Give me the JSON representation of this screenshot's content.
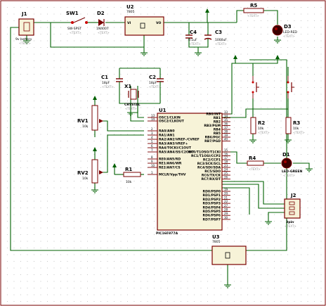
{
  "components": {
    "j1": {
      "ref": "J1",
      "value": "9v battery"
    },
    "sw1": {
      "ref": "SW1",
      "value": "SW-SPST"
    },
    "d2": {
      "ref": "D2",
      "value": "1N4007"
    },
    "u2": {
      "ref": "U2",
      "value": "7805",
      "pin_in": "VI",
      "pin_out": "VO"
    },
    "c4": {
      "ref": "C4",
      "value": "0.1uF"
    },
    "c3": {
      "ref": "C3",
      "value": "1000uF"
    },
    "r5": {
      "ref": "R5"
    },
    "d3": {
      "ref": "D3",
      "value": "LED-RED"
    },
    "c1": {
      "ref": "C1",
      "value": "18pF"
    },
    "c2": {
      "ref": "C2",
      "value": "18pF"
    },
    "x1": {
      "ref": "X1",
      "value": "CRYSTAL"
    },
    "u1": {
      "ref": "U1",
      "value": "PIC16F877A"
    },
    "rv1": {
      "ref": "RV1",
      "value": "10k"
    },
    "rv2": {
      "ref": "RV2",
      "value": "10k"
    },
    "r1": {
      "ref": "R1",
      "value": "10k"
    },
    "r2": {
      "ref": "R2",
      "value": "10k"
    },
    "r3": {
      "ref": "R3",
      "value": "10k"
    },
    "r4": {
      "ref": "R4"
    },
    "d1": {
      "ref": "D1",
      "value": "LED-GREEN"
    },
    "j2": {
      "ref": "J2",
      "value": "3pin"
    },
    "u3": {
      "ref": "U3",
      "value": "7805"
    }
  },
  "placeholder_text": "<TEXT>",
  "u1_left_pins": [
    "OSC1/CLKIN",
    "OSC2/CLKOUT",
    "RA0/AN0",
    "RA1/AN1",
    "RA2/AN2/VREF-/CVREF",
    "RA3/AN3/VREF+",
    "RA4/T0CKI/C1OUT",
    "RA5/AN4/SS/C2OUT",
    "RE0/AN5/RD",
    "RE1/AN6/WR",
    "RE2/AN7/CS",
    "MCLR/Vpp/THV"
  ],
  "u1_left_nums": [
    "13",
    "14",
    "2",
    "3",
    "4",
    "5",
    "6",
    "7",
    "8",
    "9",
    "10",
    "1"
  ],
  "u1_right_pins": [
    "RB0/INT",
    "RB1",
    "RB2",
    "RB3/PGM",
    "RB4",
    "RB5",
    "RB6/PGC",
    "RB7/PGD",
    "RC0/T1OSO/T1CKI",
    "RC1/T1OSI/CCP2",
    "RC2/CCP1",
    "RC3/SCK/SCL",
    "RC4/SDI/SDA",
    "RC5/SDO",
    "RC6/TX/CK",
    "RC7/RX/DT",
    "RD0/PSP0",
    "RD1/PSP1",
    "RD2/PSP2",
    "RD3/PSP3",
    "RD4/PSP4",
    "RD5/PSP5",
    "RD6/PSP6",
    "RD7/PSP7"
  ],
  "u1_right_nums": [
    "33",
    "34",
    "35",
    "36",
    "37",
    "38",
    "39",
    "40",
    "15",
    "16",
    "17",
    "18",
    "23",
    "24",
    "25",
    "26",
    "19",
    "20",
    "21",
    "22",
    "27",
    "28",
    "29",
    "30"
  ]
}
